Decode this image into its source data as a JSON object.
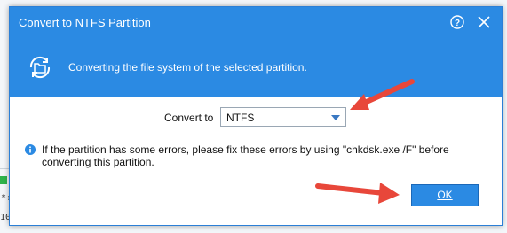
{
  "dialog": {
    "title": "Convert to NTFS Partition",
    "help_icon": "help-icon",
    "close_icon": "close-icon",
    "accent_color": "#2b8ae3"
  },
  "banner": {
    "icon": "convert-folder-icon",
    "text": "Converting the file system of the selected partition."
  },
  "form": {
    "convert_to_label": "Convert to",
    "convert_to_value": "NTFS"
  },
  "info": {
    "icon": "info-icon",
    "text": "If the partition has some errors, please fix these errors by using \"chkdsk.exe /F\" before converting this partition."
  },
  "buttons": {
    "ok_label": "OK"
  },
  "annotations": {
    "arrow_color": "#e8473a"
  },
  "background": {
    "fragment_1": "*:",
    "fragment_2": "10"
  }
}
